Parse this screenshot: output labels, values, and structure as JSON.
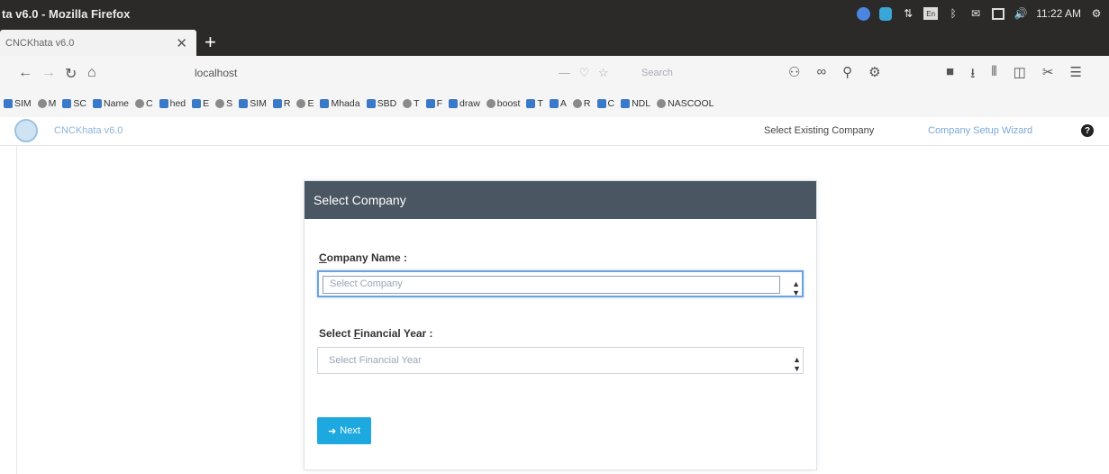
{
  "window": {
    "title": "ta v6.0 - Mozilla Firefox"
  },
  "system_tray": {
    "time": "11:22 AM"
  },
  "browser": {
    "tab_title": "CNCKhata v6.0",
    "url": "localhost",
    "search_placeholder": "Search",
    "bookmarks": [
      "SIM",
      "M",
      "SC",
      "Name",
      "C",
      "hed",
      "E",
      "S",
      "SIM",
      "R",
      "E",
      "Mhada",
      "SBD",
      "T",
      "F",
      "draw",
      "boost",
      "T",
      "A",
      "R",
      "C",
      "NDL",
      "NASCOOL"
    ]
  },
  "app_header": {
    "app_name": "CNCKhata v6.0",
    "select_existing_company": "Select Existing Company",
    "company_wizard": "Company Setup Wizard",
    "help_icon": "?"
  },
  "panel": {
    "title": "Select Company",
    "company_label_prefix": "C",
    "company_label_rest": "ompany Name :",
    "company_placeholder": "Select Company",
    "year_label_prefix": "Select ",
    "year_label_u": "F",
    "year_label_rest": "inancial Year :",
    "year_placeholder": "Select Financial Year",
    "go_button_icon": "➜",
    "go_button_label": "Next"
  }
}
